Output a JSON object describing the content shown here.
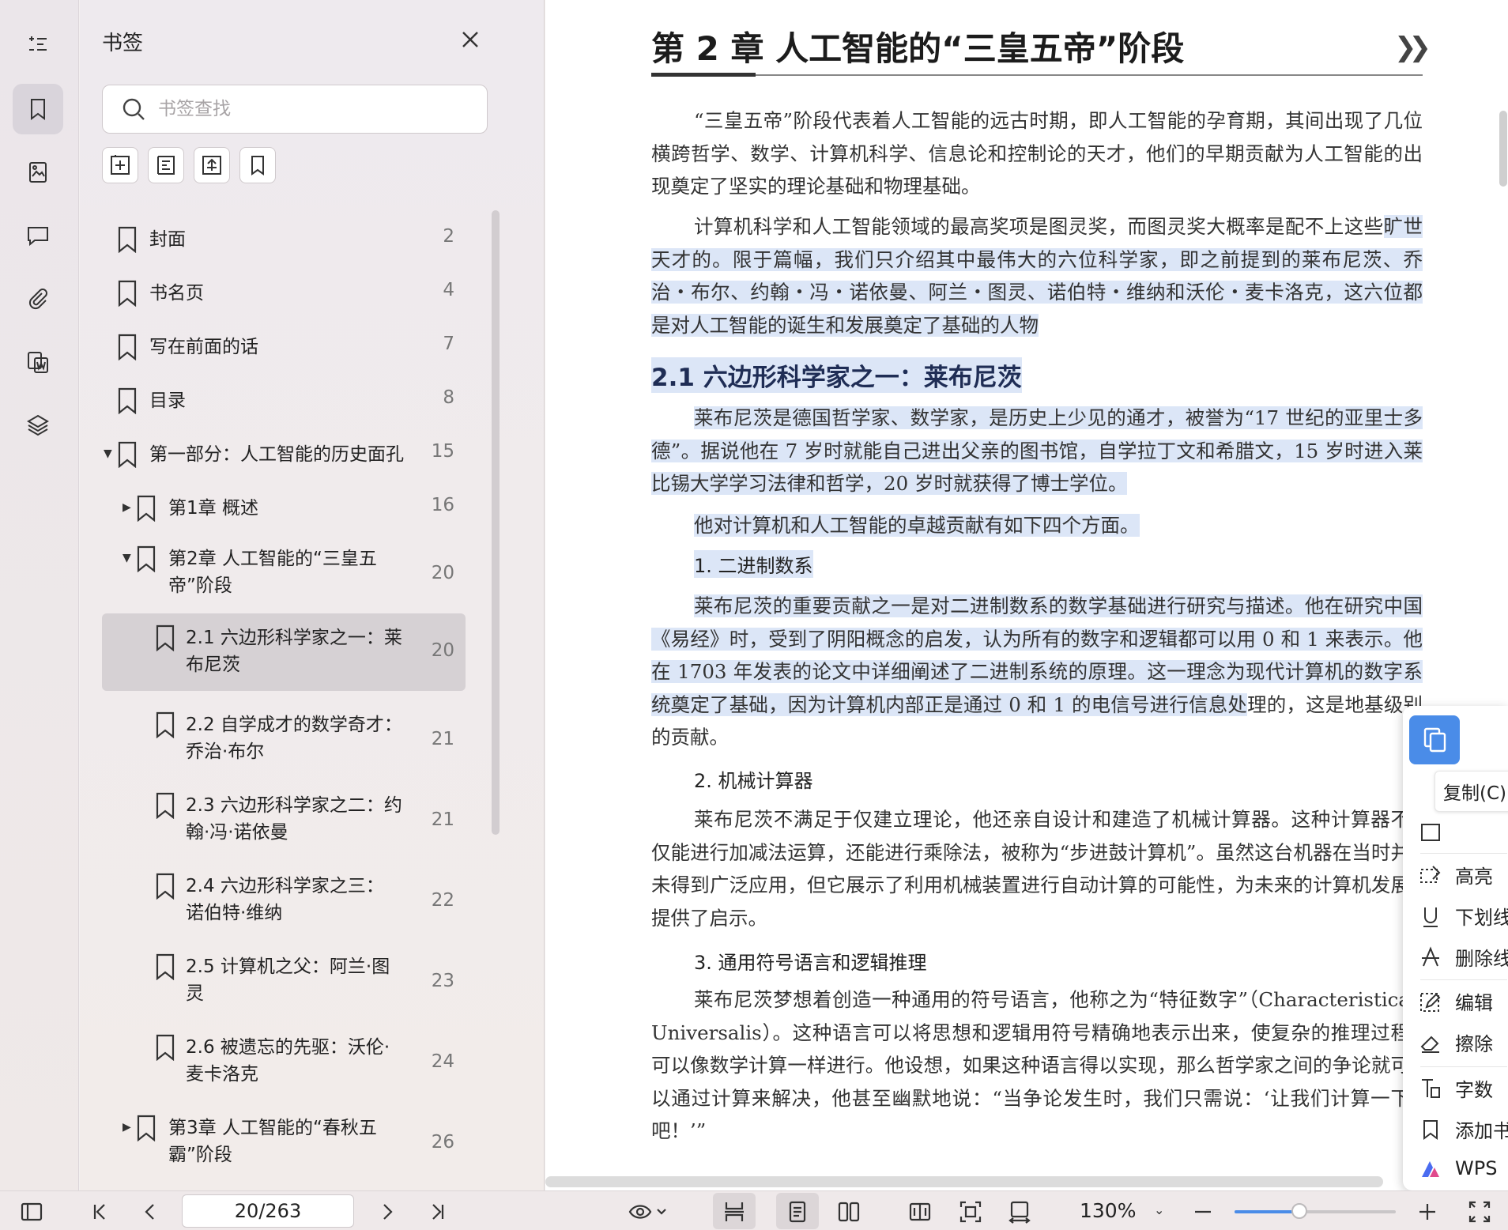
{
  "panel": {
    "title": "书签",
    "search_placeholder": "书签查找"
  },
  "bookmarks": [
    {
      "label": "封面",
      "page": "2",
      "level": 0,
      "caret": ""
    },
    {
      "label": "书名页",
      "page": "4",
      "level": 0,
      "caret": ""
    },
    {
      "label": "写在前面的话",
      "page": "7",
      "level": 0,
      "caret": ""
    },
    {
      "label": "目录",
      "page": "8",
      "level": 0,
      "caret": ""
    },
    {
      "label": "第一部分：人工智能的历史面孔",
      "page": "15",
      "level": 0,
      "caret": "▼"
    },
    {
      "label": "第1章 概述",
      "page": "16",
      "level": 1,
      "caret": "▶"
    },
    {
      "label1": "第2章 人工智能的“三皇五",
      "label2": "帝”阶段",
      "page": "20",
      "level": 1,
      "caret": "▼"
    },
    {
      "label1": "2.1 六边形科学家之一：莱",
      "label2": "布尼茨",
      "page": "20",
      "level": 2,
      "caret": "",
      "active": true
    },
    {
      "label1": "2.2 自学成才的数学奇才：",
      "label2": "乔治·布尔",
      "page": "21",
      "level": 2,
      "caret": ""
    },
    {
      "label1": "2.3 六边形科学家之二：约",
      "label2": "翰·冯·诺依曼",
      "page": "21",
      "level": 2,
      "caret": ""
    },
    {
      "label1": "2.4 六边形科学家之三：",
      "label2": "诺伯特·维纳",
      "page": "22",
      "level": 2,
      "caret": ""
    },
    {
      "label1": "2.5 计算机之父：阿兰·图",
      "label2": "灵",
      "page": "23",
      "level": 2,
      "caret": ""
    },
    {
      "label1": "2.6 被遗忘的先驱：沃伦·",
      "label2": "麦卡洛克",
      "page": "24",
      "level": 2,
      "caret": ""
    },
    {
      "label1": "第3章 人工智能的“春秋五",
      "label2": "霸”阶段",
      "page": "26",
      "level": 1,
      "caret": "▶"
    }
  ],
  "document": {
    "chapter_title": "第 2 章   人工智能的“三皇五帝”阶段",
    "p1": "“三皇五帝”阶段代表着人工智能的远古时期，即人工智能的孕育期，其间出现了几位横跨哲学、数学、计算机科学、信息论和控制论的天才，他们的早期贡献为人工智能的出现奠定了坚实的理论基础和物理基础。",
    "p2a": "计算机科学和人工智能领域的最高奖项是图灵奖，而图灵奖大概率是配不上这些",
    "p2b": "旷世天才的。限于篇幅，我们只介绍其中最伟大的六位科学家，即之前提到的莱布尼茨、乔治・布尔、约翰・冯・诺依曼、阿兰・图灵、诺伯特・维纳和沃伦・麦卡洛克，这六位都是对人工智能的诞生和发展奠定了基础的人物",
    "h2_1": "2.1   六边形科学家之一：莱布尼茨",
    "p3": "莱布尼茨是德国哲学家、数学家，是历史上少见的通才，被誉为“17 世纪的亚里士多德”。据说他在 7 岁时就能自己进出父亲的图书馆，自学拉丁文和希腊文，15 岁时进入莱比锡大学学习法律和哲学，20 岁时就获得了博士学位。",
    "p4": "他对计算机和人工智能的卓越贡献有如下四个方面。",
    "h3_1": "1. 二进制数系",
    "p5a": "莱布尼茨的重要贡献之一是对二进制数系的数学基础进行研究与描述。他在研究中国《易经》时，受到了阴阳概念的启发，认为所有的数字和逻辑都可以用 0 和 1 来表示。他在 1703 年发表的论文中详细阐述了二进制系统的原理。这一理念为现代计算机的数字系统奠定了基础，因为计算机内部正是通过 0 和 1 的电信号进行信息处",
    "p5b": "理的，这是地基级别的贡献。",
    "h3_2": "2. 机械计算器",
    "p6": "莱布尼茨不满足于仅建立理论，他还亲自设计和建造了机械计算器。这种计算器不仅能进行加减法运算，还能进行乘除法，被称为“步进鼓计算机”。虽然这台机器在当时并未得到广泛应用，但它展示了利用机械装置进行自动计算的可能性，为未来的计算机发展提供了启示。",
    "h3_3": "3. 通用符号语言和逻辑推理",
    "p7": "莱布尼茨梦想着创造一种通用的符号语言，他称之为“特征数字”（Characteristica Universalis）。这种语言可以将思想和逻辑用符号精确地表示出来，使复杂的推理过程可以像数学计算一样进行。他设想，如果这种语言得以实现，那么哲学家之间的争论就可以通过计算来解决，他甚至幽默地说：“当争论发生时，我们只需说：‘让我们计算一下吧！’”"
  },
  "context_menu": {
    "copy_tooltip": "复制(C)",
    "items": [
      "高亮",
      "下划线",
      "删除线",
      "编辑",
      "擦除",
      "字数",
      "添加书签",
      "WPS"
    ]
  },
  "statusbar": {
    "page_indicator": "20/263",
    "zoom": "130%",
    "zoom_fraction": 0.4
  }
}
